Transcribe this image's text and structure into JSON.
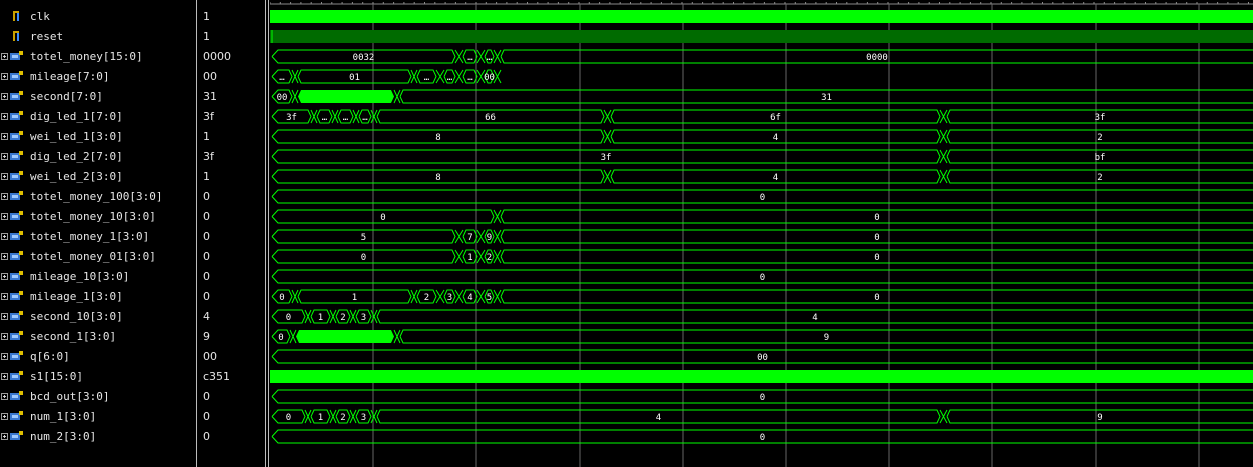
{
  "signals": [
    {
      "name": "clk",
      "value": "1",
      "icon": "bit-signal-icon",
      "expandable": false
    },
    {
      "name": "reset",
      "value": "1",
      "icon": "bit-signal-icon",
      "expandable": false
    },
    {
      "name": "totel_money[15:0]",
      "value": "0000",
      "icon": "bus-signal-icon",
      "expandable": true
    },
    {
      "name": "mileage[7:0]",
      "value": "00",
      "icon": "bus-signal-icon",
      "expandable": true
    },
    {
      "name": "second[7:0]",
      "value": "31",
      "icon": "bus-signal-icon",
      "expandable": true
    },
    {
      "name": "dig_led_1[7:0]",
      "value": "3f",
      "icon": "bus-signal-icon",
      "expandable": true
    },
    {
      "name": "wei_led_1[3:0]",
      "value": "1",
      "icon": "bus-signal-icon",
      "expandable": true
    },
    {
      "name": "dig_led_2[7:0]",
      "value": "3f",
      "icon": "bus-signal-icon",
      "expandable": true
    },
    {
      "name": "wei_led_2[3:0]",
      "value": "1",
      "icon": "bus-signal-icon",
      "expandable": true
    },
    {
      "name": "totel_money_100[3:0]",
      "value": "0",
      "icon": "bus-signal-icon",
      "expandable": true
    },
    {
      "name": "totel_money_10[3:0]",
      "value": "0",
      "icon": "bus-signal-icon",
      "expandable": true
    },
    {
      "name": "totel_money_1[3:0]",
      "value": "0",
      "icon": "bus-signal-icon",
      "expandable": true
    },
    {
      "name": "totel_money_01[3:0]",
      "value": "0",
      "icon": "bus-signal-icon",
      "expandable": true
    },
    {
      "name": "mileage_10[3:0]",
      "value": "0",
      "icon": "bus-signal-icon",
      "expandable": true
    },
    {
      "name": "mileage_1[3:0]",
      "value": "0",
      "icon": "bus-signal-icon",
      "expandable": true
    },
    {
      "name": "second_10[3:0]",
      "value": "4",
      "icon": "bus-signal-icon",
      "expandable": true
    },
    {
      "name": "second_1[3:0]",
      "value": "9",
      "icon": "bus-signal-icon",
      "expandable": true
    },
    {
      "name": "q[6:0]",
      "value": "00",
      "icon": "bus-signal-icon",
      "expandable": true
    },
    {
      "name": "s1[15:0]",
      "value": "c351",
      "icon": "bus-signal-icon",
      "expandable": true
    },
    {
      "name": "bcd_out[3:0]",
      "value": "0",
      "icon": "bus-signal-icon",
      "expandable": true
    },
    {
      "name": "num_1[3:0]",
      "value": "0",
      "icon": "bus-signal-icon",
      "expandable": true
    },
    {
      "name": "num_2[3:0]",
      "value": "0",
      "icon": "bus-signal-icon",
      "expandable": true
    }
  ],
  "waves": [
    {
      "kind": "solid"
    },
    {
      "kind": "dark"
    },
    {
      "kind": "bus",
      "segs": [
        {
          "l": "0032"
        },
        {
          "l": "…"
        },
        {
          "l": "…"
        },
        {
          "l": "0000"
        }
      ]
    },
    {
      "kind": "bus",
      "segs": [
        {
          "l": "…"
        },
        {
          "l": "01"
        },
        {
          "l": "…"
        },
        {
          "l": "…"
        },
        {
          "l": "…"
        },
        {
          "l": "00"
        }
      ]
    },
    {
      "kind": "bus",
      "segs": [
        {
          "l": "00"
        },
        {
          "fill": true
        },
        {
          "l": "31"
        }
      ]
    },
    {
      "kind": "bus",
      "segs": [
        {
          "l": "3f"
        },
        {
          "l": "…"
        },
        {
          "l": "…"
        },
        {
          "l": "…"
        },
        {
          "l": "66"
        },
        {
          "l": "6f"
        },
        {
          "l": "3f"
        }
      ]
    },
    {
      "kind": "bus",
      "segs": [
        {
          "l": "8"
        },
        {
          "l": "4"
        },
        {
          "l": "2"
        }
      ]
    },
    {
      "kind": "bus",
      "segs": [
        {
          "l": "3f"
        },
        {
          "l": "bf"
        }
      ]
    },
    {
      "kind": "bus",
      "segs": [
        {
          "l": "8"
        },
        {
          "l": "4"
        },
        {
          "l": "2"
        }
      ]
    },
    {
      "kind": "bus",
      "segs": [
        {
          "l": "0"
        }
      ]
    },
    {
      "kind": "bus",
      "segs": [
        {
          "l": "0"
        },
        {
          "l": "0"
        }
      ]
    },
    {
      "kind": "bus",
      "segs": [
        {
          "l": "5"
        },
        {
          "l": "7"
        },
        {
          "l": "9"
        },
        {
          "l": "0"
        }
      ]
    },
    {
      "kind": "bus",
      "segs": [
        {
          "l": "0"
        },
        {
          "l": "1"
        },
        {
          "l": "2"
        },
        {
          "l": "0"
        }
      ]
    },
    {
      "kind": "bus",
      "segs": [
        {
          "l": "0"
        }
      ]
    },
    {
      "kind": "bus",
      "segs": [
        {
          "l": "0"
        },
        {
          "l": "1"
        },
        {
          "l": "2"
        },
        {
          "l": "3"
        },
        {
          "l": "4"
        },
        {
          "l": "5"
        },
        {
          "l": "0"
        }
      ]
    },
    {
      "kind": "bus",
      "segs": [
        {
          "l": "0"
        },
        {
          "l": "1"
        },
        {
          "l": "2"
        },
        {
          "l": "3"
        },
        {
          "l": "4"
        }
      ]
    },
    {
      "kind": "bus",
      "segs": [
        {
          "l": "0"
        },
        {
          "fill": true
        },
        {
          "l": "9"
        }
      ]
    },
    {
      "kind": "bus",
      "segs": [
        {
          "l": "00"
        }
      ]
    },
    {
      "kind": "solid"
    },
    {
      "kind": "bus",
      "segs": [
        {
          "l": "0"
        }
      ]
    },
    {
      "kind": "bus",
      "segs": [
        {
          "l": "0"
        },
        {
          "l": "1"
        },
        {
          "l": "2"
        },
        {
          "l": "3"
        },
        {
          "l": "4"
        },
        {
          "l": "9"
        },
        {
          "l": "0"
        }
      ]
    },
    {
      "kind": "bus",
      "segs": [
        {
          "l": "0"
        }
      ]
    }
  ],
  "colors": {
    "wave": "#00ff00",
    "wave_dark": "#006b00",
    "grid": "#666666",
    "text": "#ffffff",
    "background": "#000000"
  }
}
